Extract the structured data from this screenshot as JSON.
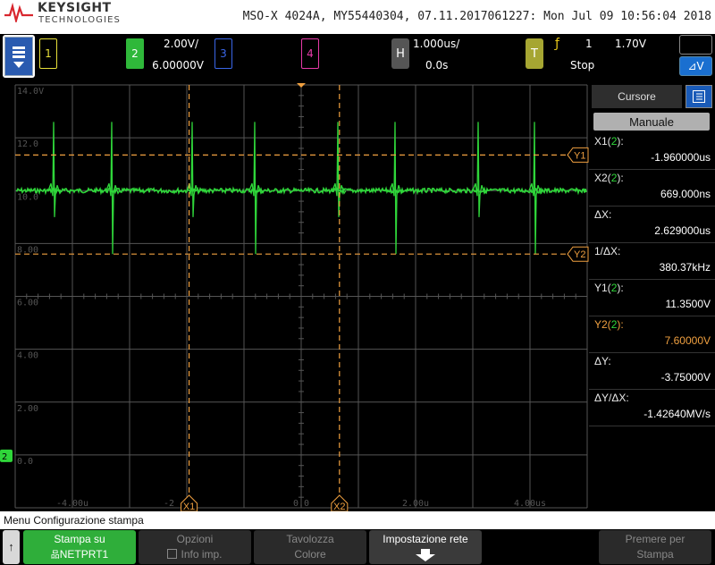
{
  "header": {
    "brand": "KEYSIGHT",
    "brand_sub": "TECHNOLOGIES",
    "instrument_info": "MSO-X 4024A, MY55440304, 07.11.2017061227: Mon Jul 09 10:56:04 2018"
  },
  "topbar": {
    "channels": [
      {
        "num": "1",
        "color": "#e8e03a"
      },
      {
        "num": "2",
        "color": "#2fd63a",
        "scale": "2.00V/",
        "offset": "6.00000V"
      },
      {
        "num": "3",
        "color": "#3a66e8"
      },
      {
        "num": "4",
        "color": "#e83aa8"
      }
    ],
    "horizontal": {
      "label": "H",
      "timebase": "1.000us/",
      "delay": "0.0s"
    },
    "trigger": {
      "label": "T",
      "slope": "ƒ",
      "source": "1",
      "level": "1.70V",
      "state": "Stop"
    }
  },
  "graticule": {
    "y_labels": [
      "14.0V",
      "12.0",
      "10.0",
      "8.00",
      "6.00",
      "4.00",
      "2.00",
      "0.0"
    ],
    "x_labels": [
      "-4.00u",
      "-2",
      "0.0",
      "2.00u",
      "4.00us"
    ],
    "channel_marker": "2",
    "cursor_tags": {
      "x1": "X1",
      "x2": "X2",
      "y1": "Y1",
      "y2": "Y2"
    },
    "colors": {
      "grid": "#555555",
      "trace": "#2fd63a",
      "cursor": "#f0a040",
      "label": "#555555"
    }
  },
  "side_panel": {
    "tab_title": "Cursore",
    "mode": "Manuale",
    "rows": [
      {
        "label_pre": "X1(",
        "label_ch": "2",
        "label_post": "):",
        "value": "-1.960000us"
      },
      {
        "label_pre": "X2(",
        "label_ch": "2",
        "label_post": "):",
        "value": "669.000ns"
      },
      {
        "label_pre": "ΔX:",
        "label_ch": "",
        "label_post": "",
        "value": "2.629000us"
      },
      {
        "label_pre": "1/ΔX:",
        "label_ch": "",
        "label_post": "",
        "value": "380.37kHz"
      },
      {
        "label_pre": "Y1(",
        "label_ch": "2",
        "label_post": "):",
        "value": "11.3500V"
      },
      {
        "label_pre": "Y2(",
        "label_ch": "2",
        "label_post": "):",
        "value": "7.60000V",
        "highlight": true
      },
      {
        "label_pre": "ΔY:",
        "label_ch": "",
        "label_post": "",
        "value": "-3.75000V"
      },
      {
        "label_pre": "ΔY/ΔX:",
        "label_ch": "",
        "label_post": "",
        "value": "-1.42640MV/s"
      }
    ]
  },
  "softkeys": {
    "menu_title": "Menu Configurazione stampa",
    "print_top": "Stampa su",
    "print_bottom": "NETPRT1",
    "options_top": "Opzioni",
    "options_bottom": "Info imp.",
    "palette_top": "Tavolozza",
    "palette_bottom": "Colore",
    "network_top": "Impostazione rete",
    "press_top": "Premere per",
    "press_bottom": "Stampa"
  }
}
